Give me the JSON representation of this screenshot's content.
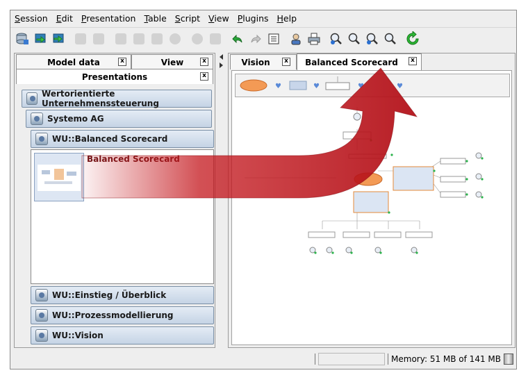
{
  "menubar": {
    "items": [
      {
        "label": "Session",
        "mnemonic": "S",
        "rest": "ession"
      },
      {
        "label": "Edit",
        "mnemonic": "E",
        "rest": "dit"
      },
      {
        "label": "Presentation",
        "mnemonic": "P",
        "rest": "resentation"
      },
      {
        "label": "Table",
        "mnemonic": "T",
        "rest": "able"
      },
      {
        "label": "Script",
        "mnemonic": "S",
        "rest": "cript"
      },
      {
        "label": "View",
        "mnemonic": "V",
        "rest": "iew"
      },
      {
        "label": "Plugins",
        "mnemonic": "P",
        "rest": "lugins"
      },
      {
        "label": "Help",
        "mnemonic": "H",
        "rest": "elp"
      }
    ]
  },
  "left_panel": {
    "tabs": [
      {
        "label": "Model data",
        "close": "x"
      },
      {
        "label": "View",
        "close": "x"
      }
    ],
    "active_tab": {
      "label": "Presentations",
      "close": "x"
    },
    "tree": [
      {
        "label": "Wertorientierte Unternehmenssteuerung"
      },
      {
        "label": "Systemo AG"
      },
      {
        "label": "WU::Balanced Scorecard"
      }
    ],
    "content": {
      "thumb_label": "Balanced Scorecard"
    },
    "bottom_items": [
      {
        "label": "WU::Einstieg / Überblick"
      },
      {
        "label": "WU::Prozessmodellierung"
      },
      {
        "label": "WU::Vision"
      }
    ]
  },
  "right_panel": {
    "tabs": [
      {
        "label": "Vision",
        "close": "x"
      },
      {
        "label": "Balanced Scorecard",
        "close": "x"
      }
    ]
  },
  "statusbar": {
    "memory": "Memory: 51 MB of 141 MB"
  },
  "colors": {
    "arrow": "#c4161c",
    "accent_blue": "#5a79a3"
  },
  "icons": [
    "save-icon",
    "import-icon",
    "export-icon",
    "undo-icon",
    "redo-icon",
    "list-icon",
    "user-icon",
    "print-icon",
    "zoom-in-icon",
    "zoom-icon",
    "zoom-out-icon",
    "zoom-fit-icon",
    "refresh-icon",
    "trash-icon",
    "close-icon"
  ]
}
